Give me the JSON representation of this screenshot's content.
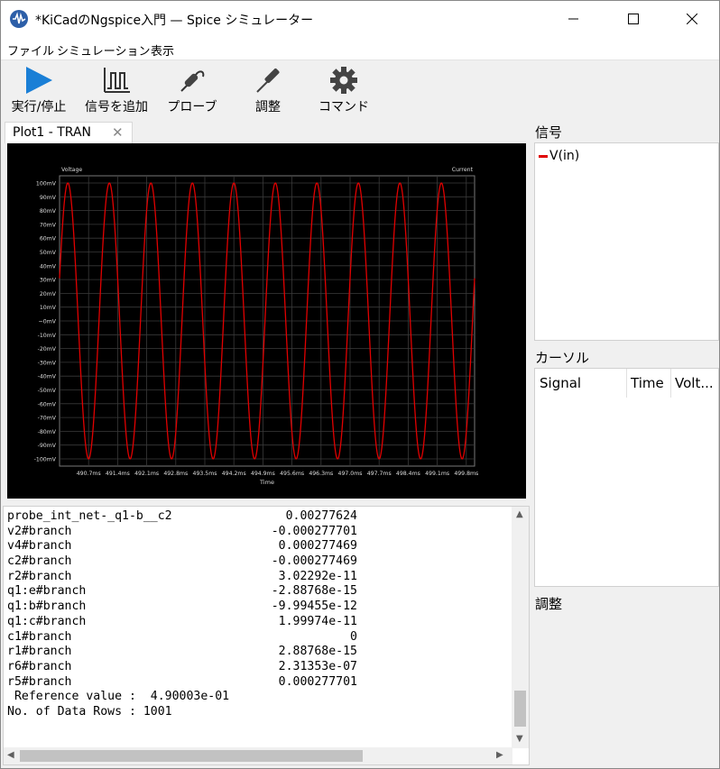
{
  "window": {
    "title": "*KiCadのNgspice入門 — Spice シミュレーター"
  },
  "menu": [
    "ファイル",
    "シミュレーション",
    "表示"
  ],
  "toolbar": {
    "run": "実行/停止",
    "add_signal": "信号を追加",
    "probe": "プローブ",
    "tune": "調整",
    "command": "コマンド"
  },
  "tab": {
    "label": "Plot1 - TRAN",
    "close": "✕"
  },
  "colors": {
    "trace": "#e00000",
    "run_icon": "#1a7fd6",
    "plot_bg": "#000000",
    "grid": "#3a3a3a"
  },
  "chart_data": {
    "type": "line",
    "left_axis_label": "Voltage",
    "right_axis_label": "Current",
    "xlabel": "Time",
    "x_ticks": [
      "490.7ms",
      "491.4ms",
      "492.1ms",
      "492.8ms",
      "493.5ms",
      "494.2ms",
      "494.9ms",
      "495.6ms",
      "496.3ms",
      "497.0ms",
      "497.7ms",
      "498.4ms",
      "499.1ms",
      "499.8ms"
    ],
    "y_ticks": [
      "100mV",
      "90mV",
      "80mV",
      "70mV",
      "60mV",
      "50mV",
      "40mV",
      "30mV",
      "20mV",
      "10mV",
      "~0mV",
      "-10mV",
      "-20mV",
      "-30mV",
      "-40mV",
      "-50mV",
      "-60mV",
      "-70mV",
      "-80mV",
      "-90mV",
      "-100mV"
    ],
    "xlim": [
      490.0,
      500.0
    ],
    "ylim": [
      -100,
      100
    ],
    "series": [
      {
        "name": "V(in)",
        "amplitude_mV": 100,
        "frequency_kHz": 1,
        "phase_ms_at_peak": 490.2
      }
    ]
  },
  "console": {
    "rows": [
      [
        "probe_int_net-_q1-b__c2",
        "0.00277624"
      ],
      [
        "v2#branch",
        "-0.000277701"
      ],
      [
        "v4#branch",
        "0.000277469"
      ],
      [
        "c2#branch",
        "-0.000277469"
      ],
      [
        "r2#branch",
        "3.02292e-11"
      ],
      [
        "q1:e#branch",
        "-2.88768e-15"
      ],
      [
        "q1:b#branch",
        "-9.99455e-12"
      ],
      [
        "q1:c#branch",
        "1.99974e-11"
      ],
      [
        "c1#branch",
        "0"
      ],
      [
        "r1#branch",
        "2.88768e-15"
      ],
      [
        "r6#branch",
        "2.31353e-07"
      ],
      [
        "r5#branch",
        "0.000277701"
      ]
    ],
    "reference_line": " Reference value :  4.90003e-01",
    "rows_line": "No. of Data Rows : 1001"
  },
  "signals_panel": {
    "title": "信号",
    "items": [
      "V(in)"
    ]
  },
  "cursor_panel": {
    "title": "カーソル",
    "columns": [
      "Signal",
      "Time",
      "Volt..."
    ]
  },
  "tune_panel": {
    "title": "調整"
  }
}
